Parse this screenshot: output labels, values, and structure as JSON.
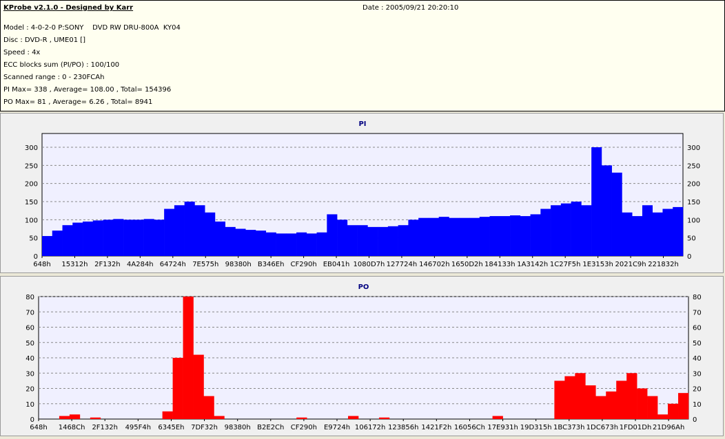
{
  "header": {
    "title": "KProbe v2.1.0 - Designed by Karr",
    "date": "Date : 2005/09/21 20:20:10",
    "lines": [
      "Model : 4-0-2-0 P:SONY    DVD RW DRU-800A  KY04",
      "Disc : DVD-R , UME01 []",
      "Speed : 4x",
      "ECC blocks sum (PI/PO) : 100/100",
      "Scanned range : 0 - 230FCAh",
      "PI Max= 338 , Average= 108.00 , Total= 154396",
      "PO Max= 81 , Average= 6.26 , Total= 8941"
    ]
  },
  "colors": {
    "pi": "#0000ff",
    "po": "#ff0000",
    "plot_bg": "#f0f0ff"
  },
  "chart_data": [
    {
      "type": "bar",
      "title": "PI",
      "ylim": [
        0,
        338
      ],
      "yticks": [
        0,
        50,
        100,
        150,
        200,
        250,
        300
      ],
      "xticks": [
        "648h",
        "15312h",
        "2F132h",
        "4A284h",
        "64724h",
        "7E575h",
        "98380h",
        "B346Eh",
        "CF290h",
        "EB041h",
        "1080D7h",
        "127724h",
        "146702h",
        "1650D2h",
        "184133h",
        "1A3142h",
        "1C27F5h",
        "1E3153h",
        "2021C9h",
        "221832h"
      ],
      "values": [
        55,
        70,
        85,
        92,
        95,
        98,
        100,
        102,
        100,
        100,
        102,
        100,
        130,
        140,
        150,
        140,
        120,
        95,
        80,
        75,
        72,
        70,
        65,
        62,
        62,
        65,
        62,
        65,
        115,
        100,
        85,
        85,
        80,
        80,
        82,
        85,
        100,
        105,
        105,
        108,
        105,
        105,
        105,
        108,
        110,
        110,
        112,
        110,
        115,
        130,
        140,
        145,
        150,
        140,
        300,
        250,
        230,
        120,
        110,
        140,
        120,
        130,
        135
      ]
    },
    {
      "type": "bar",
      "title": "PO",
      "ylim": [
        0,
        80
      ],
      "yticks": [
        0,
        10,
        20,
        30,
        40,
        50,
        60,
        70,
        80
      ],
      "xticks": [
        "648h",
        "1468Ch",
        "2F132h",
        "495F4h",
        "6345Eh",
        "7DF32h",
        "98380h",
        "B2E2Ch",
        "CF290h",
        "E9724h",
        "106172h",
        "123856h",
        "1421F2h",
        "16056Ch",
        "17E931h",
        "19D315h",
        "1BC373h",
        "1DC673h",
        "1FD01Dh",
        "21D96Ah"
      ],
      "values": [
        0,
        0,
        2,
        3,
        0,
        1,
        0,
        0,
        0,
        0,
        0,
        0,
        5,
        40,
        80,
        42,
        15,
        2,
        0,
        0,
        0,
        0,
        0,
        0,
        0,
        1,
        0,
        0,
        0,
        0,
        2,
        0,
        0,
        1,
        0,
        0,
        0,
        0,
        0,
        0,
        0,
        0,
        0,
        0,
        2,
        0,
        0,
        0,
        0,
        0,
        25,
        28,
        30,
        22,
        15,
        18,
        25,
        30,
        20,
        15,
        3,
        10,
        17
      ]
    }
  ]
}
